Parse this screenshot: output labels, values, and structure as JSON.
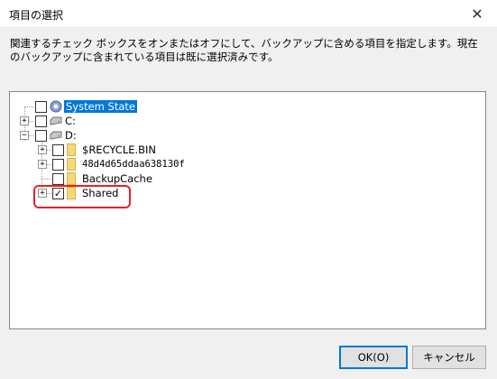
{
  "window": {
    "title": "項目の選択",
    "close_icon": "close-icon"
  },
  "description": "関連するチェック ボックスをオンまたはオフにして、バックアップに含める項目を指定します。現在のバックアップに含まれている項目は既に選択済みです。",
  "tree": {
    "items": [
      {
        "label": "System State",
        "checked": false,
        "selected": true,
        "icon": "system-state-icon"
      },
      {
        "label": "C:",
        "checked": false,
        "icon": "drive-icon",
        "expander": "+"
      },
      {
        "label": "D:",
        "checked": false,
        "icon": "drive-icon",
        "expander": "−"
      },
      {
        "label": "$RECYCLE.BIN",
        "checked": false,
        "icon": "folder-icon",
        "expander": "+"
      },
      {
        "label": "48d4d65ddaa638130f",
        "checked": false,
        "icon": "folder-icon",
        "expander": "+"
      },
      {
        "label": "BackupCache",
        "checked": false,
        "icon": "folder-icon",
        "expander": "+"
      },
      {
        "label": "Shared",
        "checked": true,
        "icon": "folder-icon",
        "expander": "+"
      }
    ]
  },
  "buttons": {
    "ok": "OK(O)",
    "cancel": "キャンセル"
  },
  "colors": {
    "selection": "#0078d7",
    "highlight_box": "#e8202a",
    "folder": "#f8d775"
  }
}
